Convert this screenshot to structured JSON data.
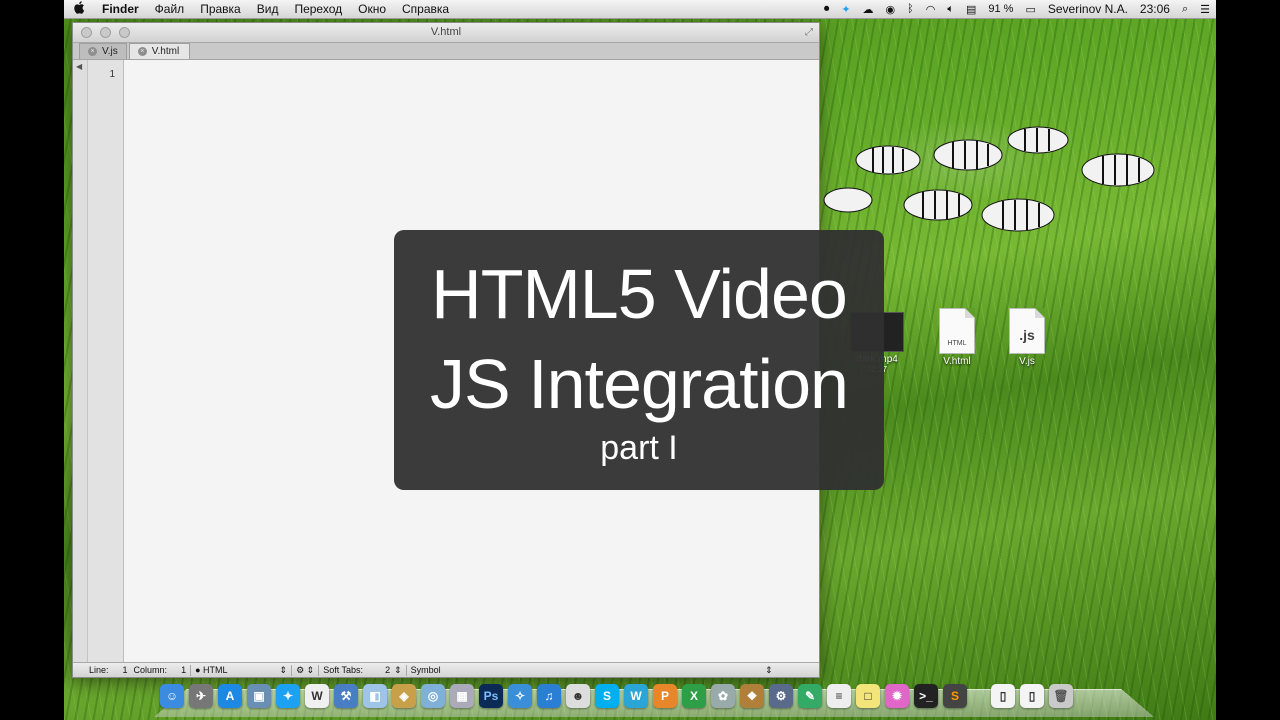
{
  "menubar": {
    "apple_icon": "apple-icon",
    "app_name": "Finder",
    "items": [
      "Файл",
      "Правка",
      "Вид",
      "Переход",
      "Окно",
      "Справка"
    ],
    "battery": "91 %",
    "user": "Severinov N.A.",
    "clock": "23:06"
  },
  "window": {
    "title": "V.html",
    "tabs": [
      {
        "label": "V.js",
        "active": false
      },
      {
        "label": "V.html",
        "active": true
      }
    ],
    "gutter_line": "1"
  },
  "statusbar": {
    "line_label": "Line:",
    "line_value": "1",
    "column_label": "Column:",
    "column_value": "1",
    "language": "HTML",
    "tabs_label": "Soft Tabs:",
    "tabs_value": "2",
    "symbol": "Symbol"
  },
  "title_card": {
    "line1": "HTML5 Video",
    "line2": "JS Integration",
    "line3": "part I"
  },
  "desktop": {
    "icons": [
      {
        "label": "dark.mp4",
        "sublabel": "02:37",
        "kind": "video"
      },
      {
        "label": "V.html",
        "kind": "html",
        "doc_text": "HTML"
      },
      {
        "label": "V.js",
        "kind": "js",
        "doc_text": ".js"
      }
    ]
  },
  "dock": {
    "apps": [
      "finder",
      "rocket",
      "appstore",
      "preview",
      "twitter",
      "word",
      "xcode",
      "box",
      "3d",
      "safari",
      "photos",
      "photoshop",
      "safari2",
      "itunes",
      "face",
      "skype",
      "wps",
      "pages",
      "x",
      "photo",
      "iphoto",
      "system",
      "vim",
      "notes",
      "terminal",
      "sublime",
      "flower",
      "terminal2",
      "tv",
      "docs",
      "docs2",
      "trash"
    ]
  },
  "colors": {
    "accent_twitter": "#1da1f2",
    "card_bg": "#303030"
  }
}
